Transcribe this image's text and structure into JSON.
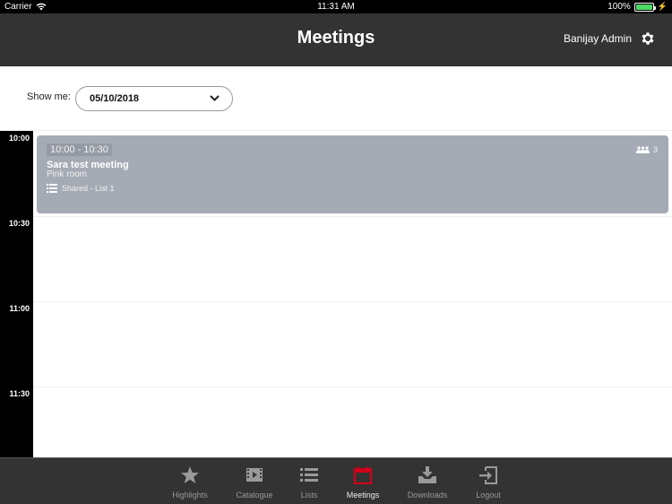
{
  "status_bar": {
    "carrier": "Carrier",
    "time": "11:31 AM",
    "battery": "100%",
    "battery_level": 1.0,
    "icons": [
      "wifi-icon",
      "battery-icon",
      "charging-icon"
    ]
  },
  "header": {
    "title": "Meetings",
    "user_name": "Banijay Admin",
    "settings_icon": "gear-icon"
  },
  "filter": {
    "label": "Show me:",
    "selected_date": "05/10/2018",
    "dropdown_icon": "chevron-down-icon"
  },
  "timeline": {
    "time_slots": [
      "10:00",
      "10:30",
      "11:00",
      "11:30"
    ],
    "events": [
      {
        "time_range": "10:00 - 10:30",
        "title": "Sara test meeting",
        "room": "Pink room",
        "list": "Shared - List 1",
        "attendee_count": "3",
        "color": "#a5abb4"
      }
    ]
  },
  "tabbar": {
    "active_color": "#d0021b",
    "tabs": [
      {
        "label": "Highlights",
        "icon": "star-icon",
        "active": false
      },
      {
        "label": "Catalogue",
        "icon": "film-icon",
        "active": false
      },
      {
        "label": "Lists",
        "icon": "list-icon",
        "active": false
      },
      {
        "label": "Meetings",
        "icon": "calendar-icon",
        "active": true
      },
      {
        "label": "Downloads",
        "icon": "download-icon",
        "active": false
      },
      {
        "label": "Logout",
        "icon": "logout-icon",
        "active": false
      }
    ]
  }
}
